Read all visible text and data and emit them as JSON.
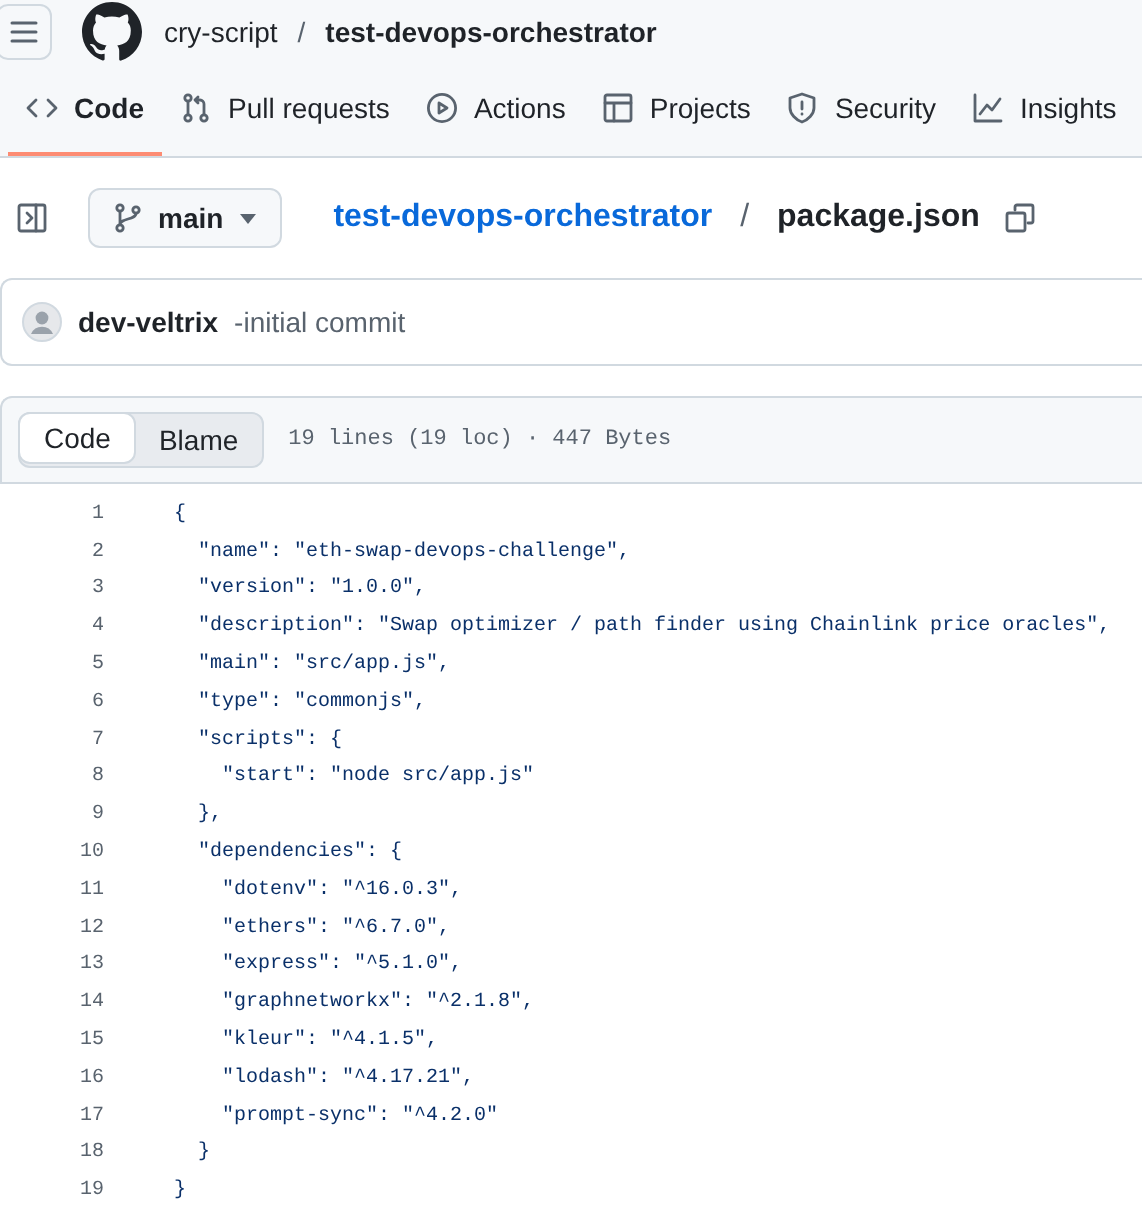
{
  "header": {
    "owner": "cry-script",
    "separator": "/",
    "repo": "test-devops-orchestrator"
  },
  "tabs": [
    {
      "label": "Code",
      "kind": "code",
      "selected": true
    },
    {
      "label": "Pull requests",
      "kind": "pull",
      "selected": false
    },
    {
      "label": "Actions",
      "kind": "play",
      "selected": false
    },
    {
      "label": "Projects",
      "kind": "table",
      "selected": false
    },
    {
      "label": "Security",
      "kind": "shield",
      "selected": false
    },
    {
      "label": "Insights",
      "kind": "graph",
      "selected": false
    }
  ],
  "file_bar": {
    "branch": "main",
    "repo_link": "test-devops-orchestrator",
    "separator": "/",
    "file": "package.json"
  },
  "commit": {
    "author": "dev-veltrix",
    "message": "-initial commit"
  },
  "code_view": {
    "modes": [
      {
        "label": "Code",
        "selected": true
      },
      {
        "label": "Blame",
        "selected": false
      }
    ],
    "info": "19 lines (19 loc) · 447 Bytes",
    "lines": [
      {
        "number": "1",
        "text": "{"
      },
      {
        "number": "2",
        "text": "  \"name\": \"eth-swap-devops-challenge\","
      },
      {
        "number": "3",
        "text": "  \"version\": \"1.0.0\","
      },
      {
        "number": "4",
        "text": "  \"description\": \"Swap optimizer / path finder using Chainlink price oracles\","
      },
      {
        "number": "5",
        "text": "  \"main\": \"src/app.js\","
      },
      {
        "number": "6",
        "text": "  \"type\": \"commonjs\","
      },
      {
        "number": "7",
        "text": "  \"scripts\": {"
      },
      {
        "number": "8",
        "text": "    \"start\": \"node src/app.js\""
      },
      {
        "number": "9",
        "text": "  },"
      },
      {
        "number": "10",
        "text": "  \"dependencies\": {"
      },
      {
        "number": "11",
        "text": "    \"dotenv\": \"^16.0.3\","
      },
      {
        "number": "12",
        "text": "    \"ethers\": \"^6.7.0\","
      },
      {
        "number": "13",
        "text": "    \"express\": \"^5.1.0\","
      },
      {
        "number": "14",
        "text": "    \"graphnetworkx\": \"^2.1.8\","
      },
      {
        "number": "15",
        "text": "    \"kleur\": \"^4.1.5\","
      },
      {
        "number": "16",
        "text": "    \"lodash\": \"^4.17.21\","
      },
      {
        "number": "17",
        "text": "    \"prompt-sync\": \"^4.2.0\""
      },
      {
        "number": "18",
        "text": "  }"
      },
      {
        "number": "19",
        "text": "}"
      }
    ]
  }
}
